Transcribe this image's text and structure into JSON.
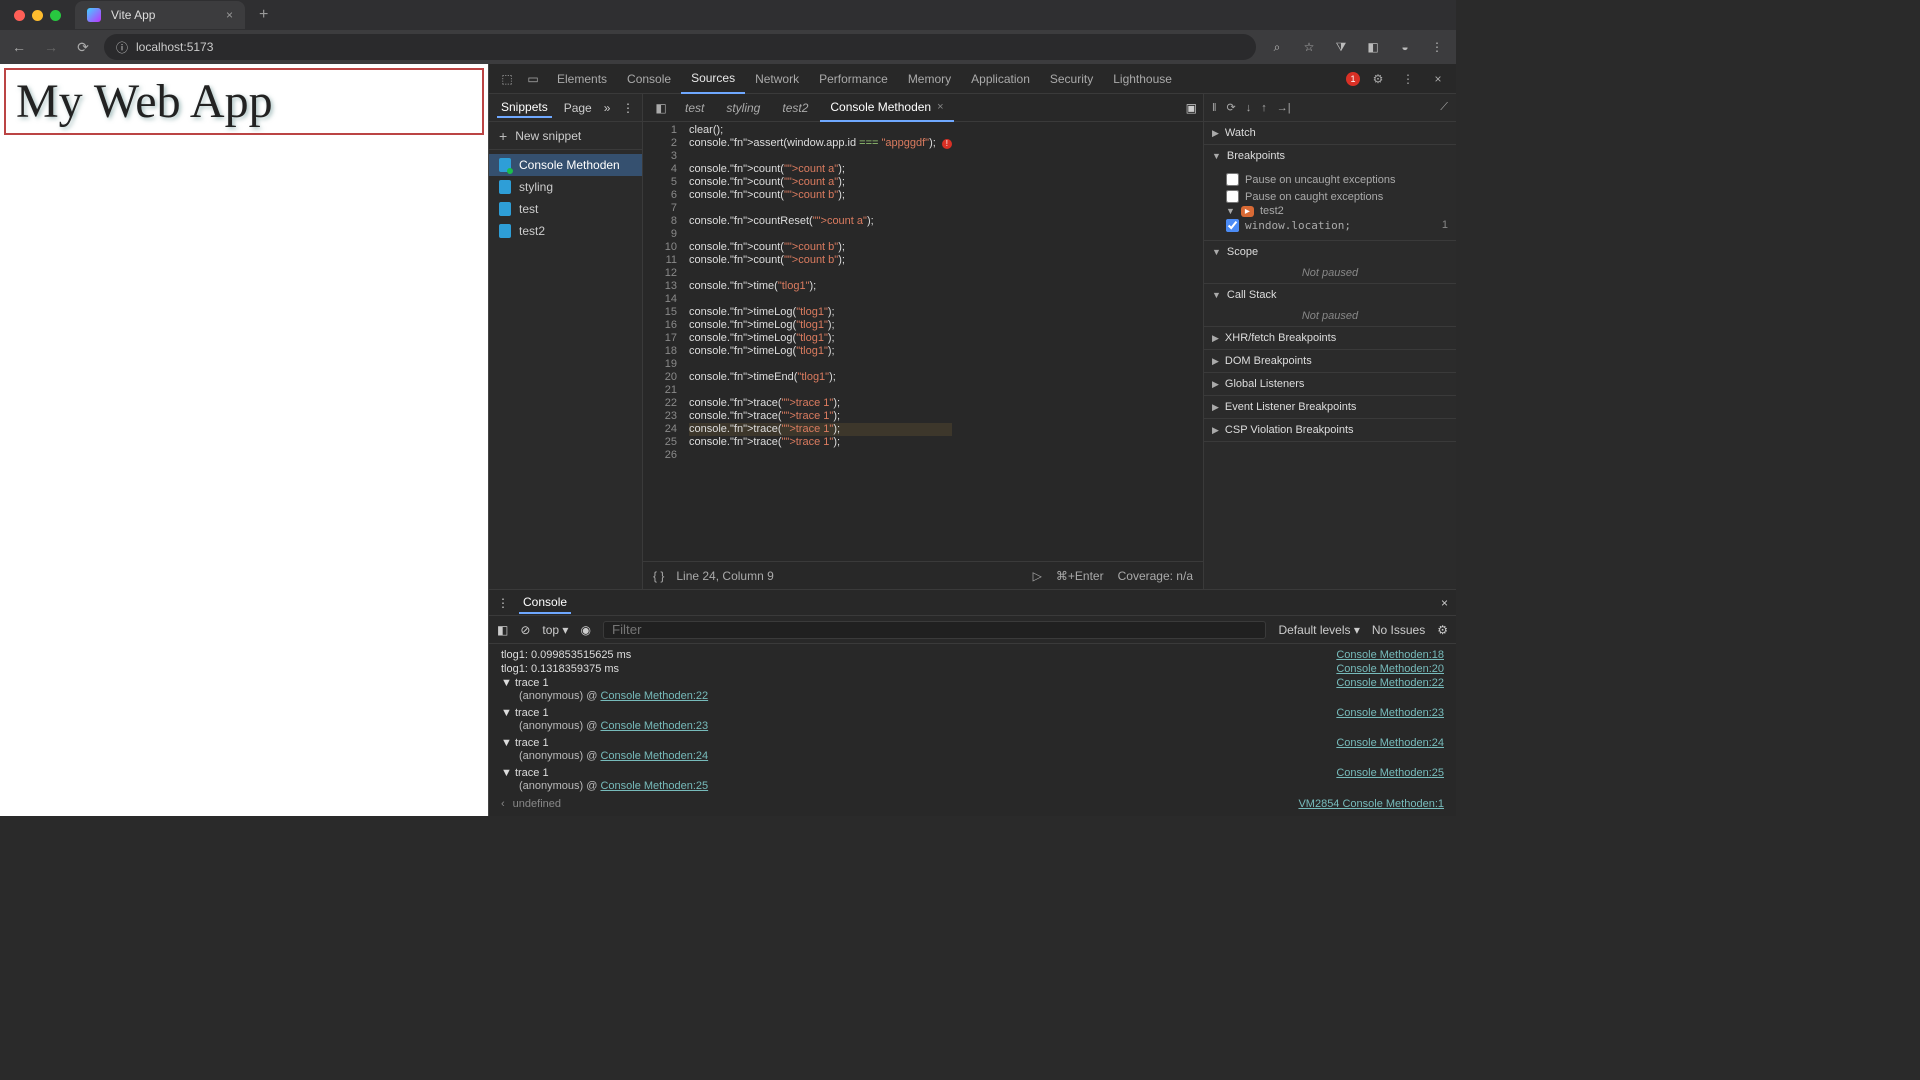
{
  "browser": {
    "tab_title": "Vite App",
    "url": "localhost:5173"
  },
  "page": {
    "heading": "My Web App"
  },
  "devtools": {
    "tabs": [
      "Elements",
      "Console",
      "Sources",
      "Network",
      "Performance",
      "Memory",
      "Application",
      "Security",
      "Lighthouse"
    ],
    "active_tab": "Sources",
    "error_count": "1"
  },
  "snippets": {
    "tab1": "Snippets",
    "tab2": "Page",
    "new_label": "New snippet",
    "items": [
      "Console Methoden",
      "styling",
      "test",
      "test2"
    ],
    "active": "Console Methoden"
  },
  "editor": {
    "tabs": [
      "test",
      "styling",
      "test2",
      "Console Methoden"
    ],
    "active": "Console Methoden",
    "code": [
      "clear();",
      "console.assert(window.app.id === \"appggdf\");",
      "",
      "console.count(\"count a\");",
      "console.count(\"count a\");",
      "console.count(\"count b\");",
      "",
      "console.countReset(\"count a\");",
      "",
      "console.count(\"count b\");",
      "console.count(\"count b\");",
      "",
      "console.time(\"tlog1\");",
      "",
      "console.timeLog(\"tlog1\");",
      "console.timeLog(\"tlog1\");",
      "console.timeLog(\"tlog1\");",
      "console.timeLog(\"tlog1\");",
      "",
      "console.timeEnd(\"tlog1\");",
      "",
      "console.trace(\"trace 1\");",
      "console.trace(\"trace 1\");",
      "console.trace(\"trace 1\");",
      "console.trace(\"trace 1\");",
      ""
    ],
    "status_pos": "Line 24, Column 9",
    "run_hint": "⌘+Enter",
    "coverage": "Coverage: n/a"
  },
  "debugger": {
    "toolbar": [
      "‖",
      "⟳",
      "↓",
      "↑",
      "→|",
      "⟋"
    ],
    "watch": "Watch",
    "breakpoints": "Breakpoints",
    "pause_uncaught": "Pause on uncaught exceptions",
    "pause_caught": "Pause on caught exceptions",
    "bp_file": "test2",
    "bp_line": "window.location;",
    "bp_line_no": "1",
    "scope": "Scope",
    "not_paused": "Not paused",
    "callstack": "Call Stack",
    "xhr": "XHR/fetch Breakpoints",
    "dom": "DOM Breakpoints",
    "global": "Global Listeners",
    "event": "Event Listener Breakpoints",
    "csp": "CSP Violation Breakpoints"
  },
  "console": {
    "drawer_tab": "Console",
    "context": "top",
    "filter_ph": "Filter",
    "levels": "Default levels",
    "issues": "No Issues",
    "output": [
      {
        "msg": "tlog1: 0.099853515625 ms",
        "src": "Console Methoden:18"
      },
      {
        "msg": "tlog1: 0.1318359375 ms",
        "src": "Console Methoden:20"
      },
      {
        "msg": "trace 1",
        "src": "Console Methoden:22",
        "stack": "(anonymous) @ Console Methoden:22"
      },
      {
        "msg": "trace 1",
        "src": "Console Methoden:23",
        "stack": "(anonymous) @ Console Methoden:23"
      },
      {
        "msg": "trace 1",
        "src": "Console Methoden:24",
        "stack": "(anonymous) @ Console Methoden:24"
      },
      {
        "msg": "trace 1",
        "src": "Console Methoden:25",
        "stack": "(anonymous) @ Console Methoden:25"
      }
    ],
    "return_val": "undefined",
    "return_src": "VM2854 Console Methoden:1"
  }
}
